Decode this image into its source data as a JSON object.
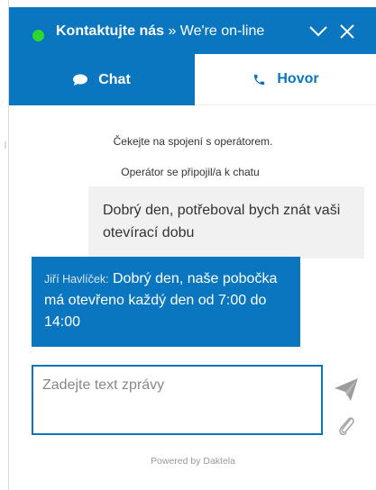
{
  "header": {
    "title_bold": "Kontaktujte nás",
    "title_rest": " » We're on-line",
    "status_color": "#2fd62f",
    "brand_color": "#0a76bf",
    "minimize_icon": "chevron-down-icon",
    "close_icon": "close-icon"
  },
  "tabs": [
    {
      "label": "Chat",
      "icon": "speech-bubble-icon",
      "active": true
    },
    {
      "label": "Hovor",
      "icon": "phone-icon",
      "active": false
    }
  ],
  "messages": {
    "system": [
      "Čekejte na spojení s operátorem.",
      "Operátor se připojil/a k chatu"
    ],
    "user": "Dobrý den, potřeboval bych znát vaši otevírací dobu",
    "operator": {
      "name": "Jiří Havlíček:",
      "text": "Dobrý den, naše pobočka má otevřeno každý den od 7:00 do 14:00"
    }
  },
  "composer": {
    "placeholder": "Zadejte text zprávy",
    "send_icon": "send-icon",
    "attach_icon": "paperclip-icon"
  },
  "footer": {
    "powered_by": "Powered by Daktela"
  }
}
